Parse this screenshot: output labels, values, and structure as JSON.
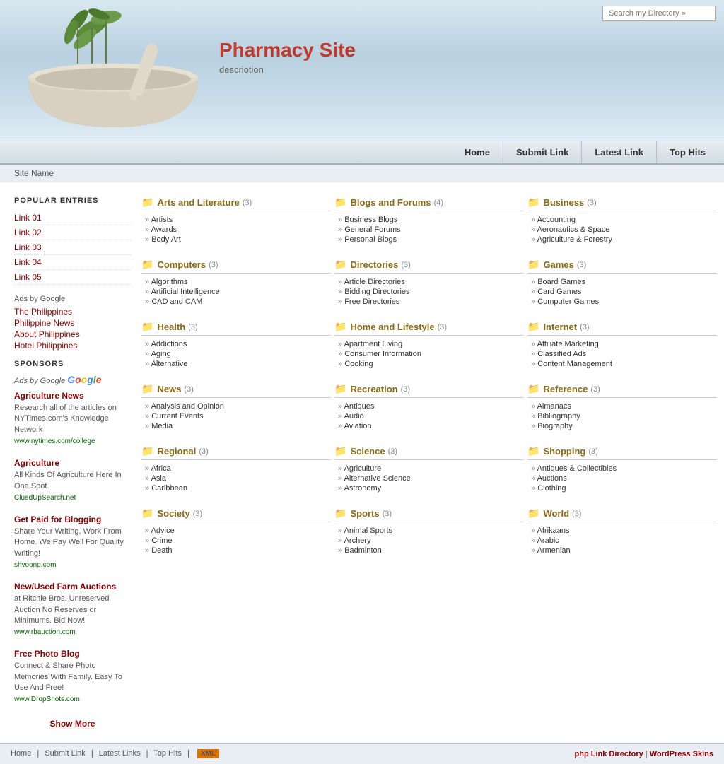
{
  "header": {
    "search_placeholder": "Search my Directory »",
    "search_button": "»",
    "site_title": "Pharmacy Site",
    "site_description": "descriotion",
    "site_name": "Site Name"
  },
  "navbar": {
    "items": [
      {
        "label": "Home",
        "href": "#"
      },
      {
        "label": "Submit Link",
        "href": "#"
      },
      {
        "label": "Latest Link",
        "href": "#"
      },
      {
        "label": "Top Hits",
        "href": "#"
      }
    ]
  },
  "sidebar": {
    "popular_section_title": "POPULAR ENTRIES",
    "popular_links": [
      {
        "label": "Link 01",
        "href": "#"
      },
      {
        "label": "Link 02",
        "href": "#"
      },
      {
        "label": "Link 03",
        "href": "#"
      },
      {
        "label": "Link 04",
        "href": "#"
      },
      {
        "label": "Link 05",
        "href": "#"
      }
    ],
    "sponsors_section_title": "SPONSORS",
    "ads_by_google_label": "Ads by Google",
    "adsense_section_label": "Ads by Google",
    "adsense_links": [
      {
        "label": "The Philippines",
        "href": "#"
      },
      {
        "label": "Philippine News",
        "href": "#"
      },
      {
        "label": "About Philippines",
        "href": "#"
      },
      {
        "label": "Hotel Philippines",
        "href": "#"
      }
    ],
    "sponsor_ads": [
      {
        "title": "Agriculture News",
        "title_href": "#",
        "description": "Research all of the articles on NYTimes.com's Knowledge Network",
        "url": "www.nytimes.com/college",
        "url_href": "#"
      },
      {
        "title": "Agriculture",
        "title_href": "#",
        "description": "All Kinds Of Agriculture Here In One Spot.",
        "url": "CluedUpSearch.net",
        "url_href": "#"
      },
      {
        "title": "Get Paid for Blogging",
        "title_href": "#",
        "description": "Share Your Writing, Work From Home. We Pay Well For Quality Writing!",
        "url": "shvoong.com",
        "url_href": "#"
      },
      {
        "title": "New/Used Farm Auctions",
        "title_href": "#",
        "description": "at Ritchie Bros. Unreserved Auction No Reserves or Minimums. Bid Now!",
        "url": "www.rbauction.com",
        "url_href": "#"
      },
      {
        "title": "Free Photo Blog",
        "title_href": "#",
        "description": "Connect & Share Photo Memories With Family. Easy To Use And Free!",
        "url": "www.DropShots.com",
        "url_href": "#"
      }
    ],
    "show_more_label": "Show More"
  },
  "directory": {
    "categories": [
      {
        "name": "Arts and Literature",
        "count": "(3)",
        "items": [
          "Artists",
          "Awards",
          "Body Art"
        ]
      },
      {
        "name": "Blogs and Forums",
        "count": "(4)",
        "items": [
          "Business Blogs",
          "General Forums",
          "Personal Blogs"
        ]
      },
      {
        "name": "Business",
        "count": "(3)",
        "items": [
          "Accounting",
          "Aeronautics & Space",
          "Agriculture & Forestry"
        ]
      },
      {
        "name": "Computers",
        "count": "(3)",
        "items": [
          "Algorithms",
          "Artificial Intelligence",
          "CAD and CAM"
        ]
      },
      {
        "name": "Directories",
        "count": "(3)",
        "items": [
          "Article Directories",
          "Bidding Directories",
          "Free Directories"
        ]
      },
      {
        "name": "Games",
        "count": "(3)",
        "items": [
          "Board Games",
          "Card Games",
          "Computer Games"
        ]
      },
      {
        "name": "Health",
        "count": "(3)",
        "items": [
          "Addictions",
          "Aging",
          "Alternative"
        ]
      },
      {
        "name": "Home and Lifestyle",
        "count": "(3)",
        "items": [
          "Apartment Living",
          "Consumer Information",
          "Cooking"
        ]
      },
      {
        "name": "Internet",
        "count": "(3)",
        "items": [
          "Affiliate Marketing",
          "Classified Ads",
          "Content Management"
        ]
      },
      {
        "name": "News",
        "count": "(3)",
        "items": [
          "Analysis and Opinion",
          "Current Events",
          "Media"
        ]
      },
      {
        "name": "Recreation",
        "count": "(3)",
        "items": [
          "Antiques",
          "Audio",
          "Aviation"
        ]
      },
      {
        "name": "Reference",
        "count": "(3)",
        "items": [
          "Almanacs",
          "Bibliography",
          "Biography"
        ]
      },
      {
        "name": "Regional",
        "count": "(3)",
        "items": [
          "Africa",
          "Asia",
          "Caribbean"
        ]
      },
      {
        "name": "Science",
        "count": "(3)",
        "items": [
          "Agriculture",
          "Alternative Science",
          "Astronomy"
        ]
      },
      {
        "name": "Shopping",
        "count": "(3)",
        "items": [
          "Antiques & Collectibles",
          "Auctions",
          "Clothing"
        ]
      },
      {
        "name": "Society",
        "count": "(3)",
        "items": [
          "Advice",
          "Crime",
          "Death"
        ]
      },
      {
        "name": "Sports",
        "count": "(3)",
        "items": [
          "Animal Sports",
          "Archery",
          "Badminton"
        ]
      },
      {
        "name": "World",
        "count": "(3)",
        "items": [
          "Afrikaans",
          "Arabic",
          "Armenian"
        ]
      }
    ]
  },
  "footer": {
    "links": [
      {
        "label": "Home"
      },
      {
        "label": "Submit Link"
      },
      {
        "label": "Latest Links"
      },
      {
        "label": "Top Hits"
      }
    ],
    "xml_label": "XML",
    "right_text1": "php Link Directory",
    "right_separator": " | ",
    "right_text2": "WordPress Skins"
  }
}
